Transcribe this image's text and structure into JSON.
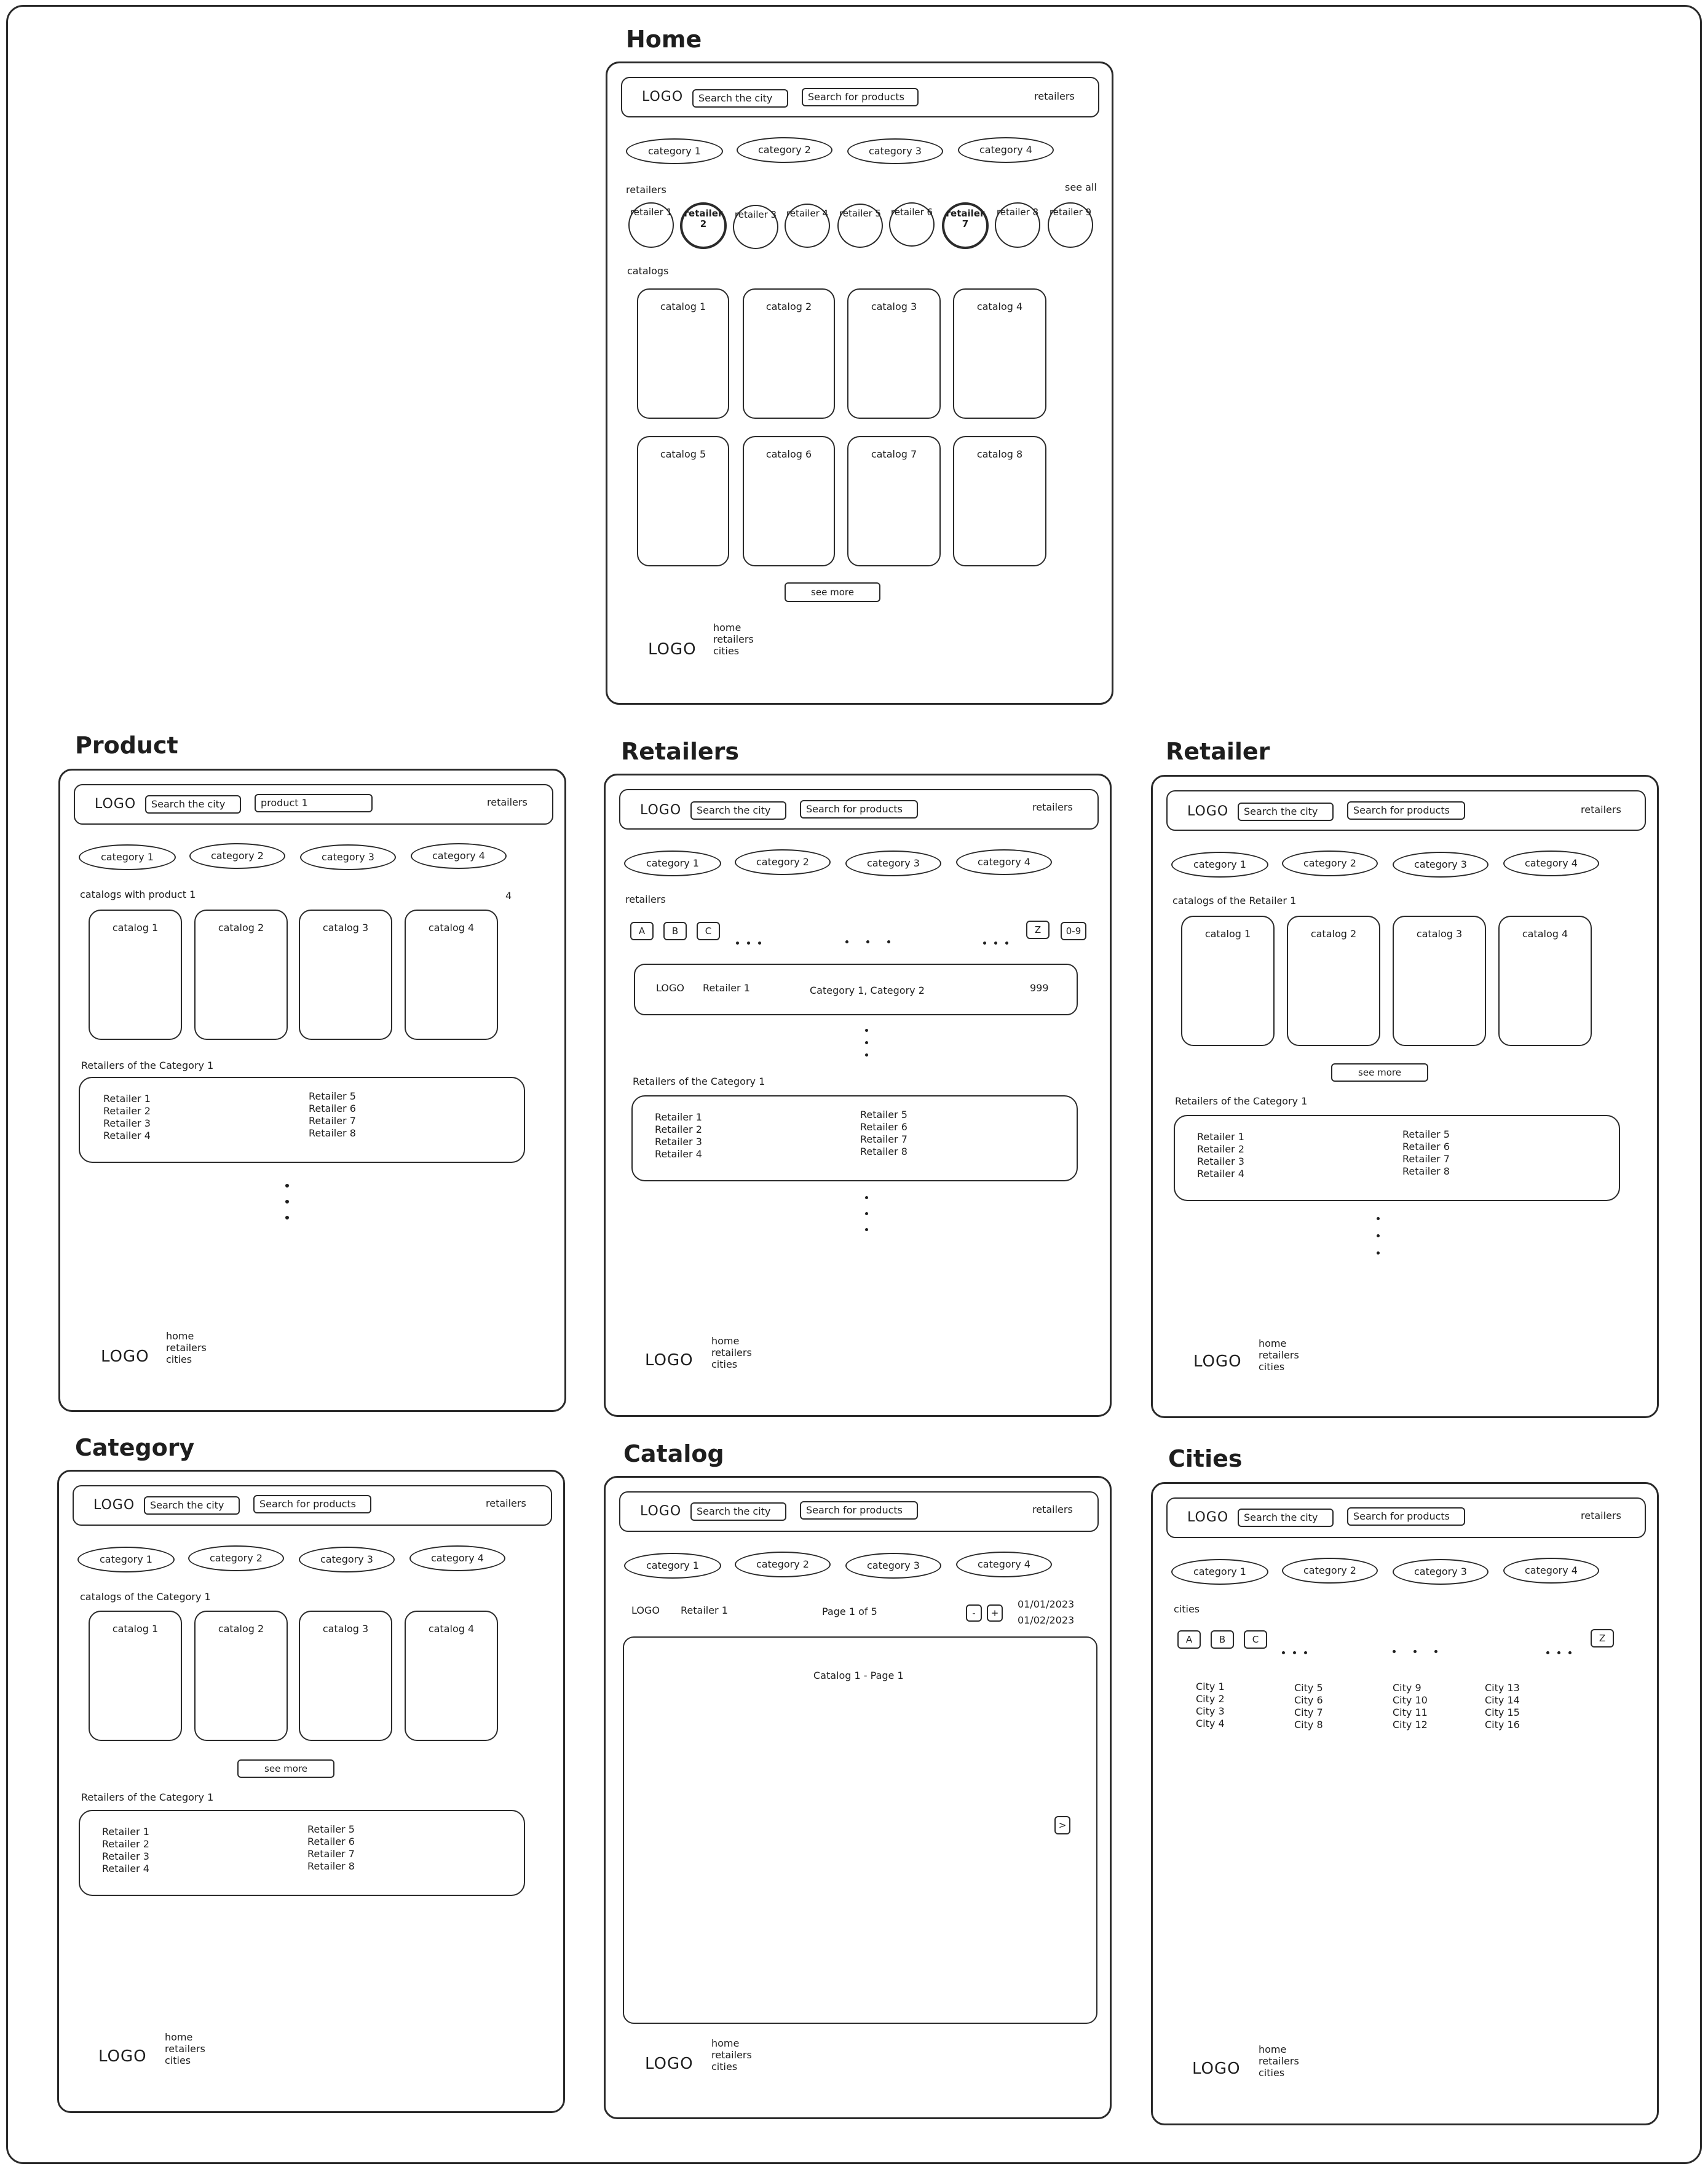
{
  "common": {
    "logo": "LOGO",
    "search_city": "Search the city",
    "search_products": "Search for products",
    "retailers_link": "retailers",
    "categories": [
      "category 1",
      "category 2",
      "category 3",
      "category 4"
    ],
    "footer_links": [
      "home",
      "retailers",
      "cities"
    ],
    "see_more": "see more"
  },
  "home": {
    "title": "Home",
    "retailers_label": "retailers",
    "see_all": "see all",
    "retailers": [
      "retailer 1",
      "retailer 2",
      "retailer 3",
      "retailer 4",
      "retailer 5",
      "retailer 6",
      "retailer 7",
      "retailer 8",
      "retailer 9"
    ],
    "catalogs_label": "catalogs",
    "catalogs": [
      "catalog 1",
      "catalog 2",
      "catalog 3",
      "catalog 4",
      "catalog 5",
      "catalog 6",
      "catalog 7",
      "catalog 8"
    ]
  },
  "product": {
    "title": "Product",
    "search_value": "product 1",
    "section_label": "catalogs with product 1",
    "count": "4",
    "catalogs": [
      "catalog 1",
      "catalog 2",
      "catalog 3",
      "catalog 4"
    ],
    "retailers_label": "Retailers of the Category 1",
    "retailers_col1": "Retailer 1\nRetailer 2\nRetailer 3\nRetailer 4",
    "retailers_col2": "Retailer 5\nRetailer 6\nRetailer 7\nRetailer 8"
  },
  "retailers": {
    "title": "Retailers",
    "section_label": "retailers",
    "letters": [
      "A",
      "B",
      "C"
    ],
    "letters_end": [
      "Z",
      "0-9"
    ],
    "row_logo": "LOGO",
    "row_name": "Retailer 1",
    "row_categories": "Category 1, Category 2",
    "row_count": "999",
    "retailers_label": "Retailers of the Category 1",
    "retailers_col1": "Retailer 1\nRetailer 2\nRetailer 3\nRetailer 4",
    "retailers_col2": "Retailer 5\nRetailer 6\nRetailer 7\nRetailer 8"
  },
  "retailer": {
    "title": "Retailer",
    "section_label": "catalogs of the Retailer 1",
    "catalogs": [
      "catalog 1",
      "catalog 2",
      "catalog 3",
      "catalog 4"
    ],
    "retailers_label": "Retailers of the Category 1",
    "retailers_col1": "Retailer 1\nRetailer 2\nRetailer 3\nRetailer 4",
    "retailers_col2": "Retailer 5\nRetailer 6\nRetailer 7\nRetailer 8"
  },
  "category": {
    "title": "Category",
    "section_label": "catalogs of the Category 1",
    "catalogs": [
      "catalog 1",
      "catalog 2",
      "catalog 3",
      "catalog 4"
    ],
    "retailers_label": "Retailers of the Category 1",
    "retailers_col1": "Retailer 1\nRetailer 2\nRetailer 3\nRetailer 4",
    "retailers_col2": "Retailer 5\nRetailer 6\nRetailer 7\nRetailer 8"
  },
  "catalog": {
    "title": "Catalog",
    "retailer_name": "Retailer 1",
    "page_info": "Page 1 of 5",
    "zoom_out": "-",
    "zoom_in": "+",
    "date_from": "01/01/2023",
    "date_to": "01/02/2023",
    "page_title": "Catalog 1 - Page 1",
    "next": ">"
  },
  "cities": {
    "title": "Cities",
    "section_label": "cities",
    "letters": [
      "A",
      "B",
      "C"
    ],
    "letters_end": [
      "Z"
    ],
    "col1": "City 1\nCity 2\nCity 3\nCity 4",
    "col2": "City 5\nCity 6\nCity 7\nCity 8",
    "col3": "City 9\nCity 10\nCity 11\nCity 12",
    "col4": "City 13\nCity 14\nCity 15\nCity 16"
  }
}
